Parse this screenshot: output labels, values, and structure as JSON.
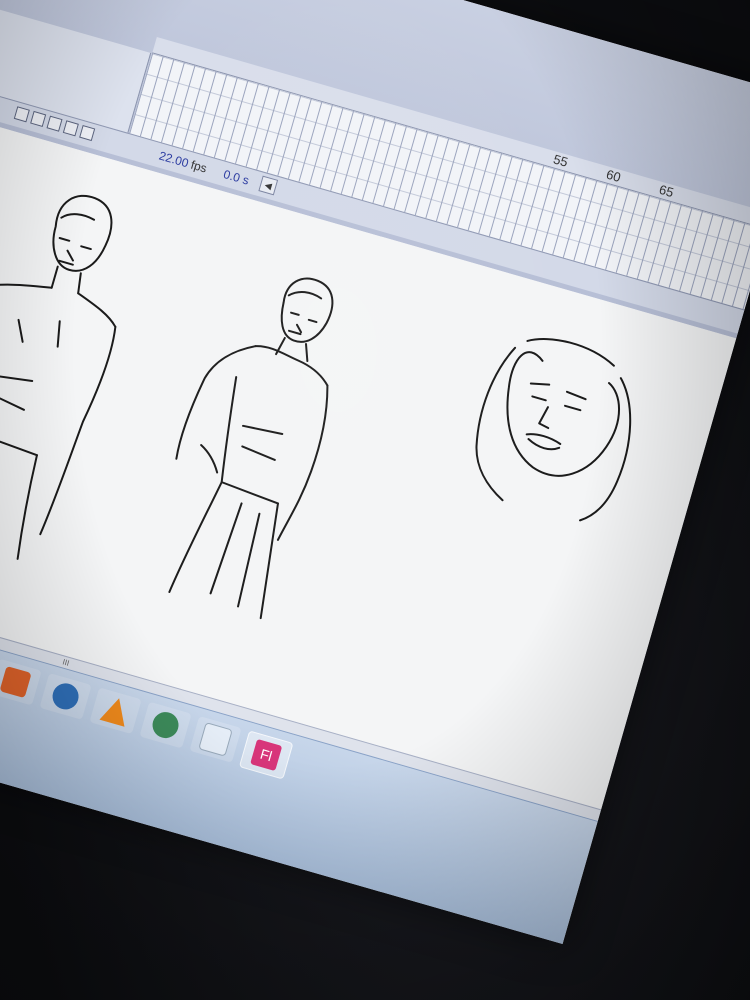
{
  "timeline": {
    "ruler_numbers": [
      "55",
      "60",
      "65"
    ],
    "fps_value": "22.00",
    "fps_unit": "fps",
    "elapsed_time": "0.0 s"
  },
  "stage": {
    "scroll_grip": "III"
  },
  "taskbar": {
    "apps": [
      {
        "icon": "windows-explorer-icon",
        "color": "#f0c64a"
      },
      {
        "icon": "media-player-icon",
        "color": "#e97a2b"
      },
      {
        "icon": "paint-icon",
        "color": "#4a7fd6"
      },
      {
        "icon": "messenger-icon",
        "color": "#46b36a"
      },
      {
        "icon": "chrome-icon",
        "color": "#d94a3b"
      },
      {
        "icon": "office-icon",
        "color": "#e0632a"
      },
      {
        "icon": "photoshop-icon",
        "color": "#2f6fb8"
      },
      {
        "icon": "vlc-icon",
        "color": "#f08a1c"
      },
      {
        "icon": "camera-icon",
        "color": "#3c8a5a"
      },
      {
        "icon": "notepad-icon",
        "color": "#e6eef8"
      },
      {
        "icon": "flash-icon",
        "color": "#d8357a"
      }
    ],
    "active_app_label": "Fl"
  }
}
